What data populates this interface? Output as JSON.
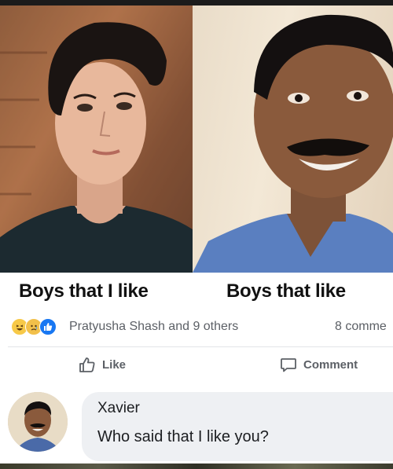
{
  "post": {
    "caption_left": "Boys that I like",
    "caption_right": "Boys that like",
    "reactions": {
      "icons": [
        "haha-icon",
        "sad-icon",
        "like-icon"
      ],
      "reactor_text": "Pratyusha Shash and 9 others",
      "comment_count": "8 comme"
    },
    "actions": {
      "like_label": "Like",
      "comment_label": "Comment"
    }
  },
  "comment": {
    "author": "Xavier",
    "text": "Who said that I like you?"
  },
  "colors": {
    "like_blue": "#1877f2",
    "secondary_text": "#5c6066",
    "bubble_bg": "#eef0f3"
  }
}
